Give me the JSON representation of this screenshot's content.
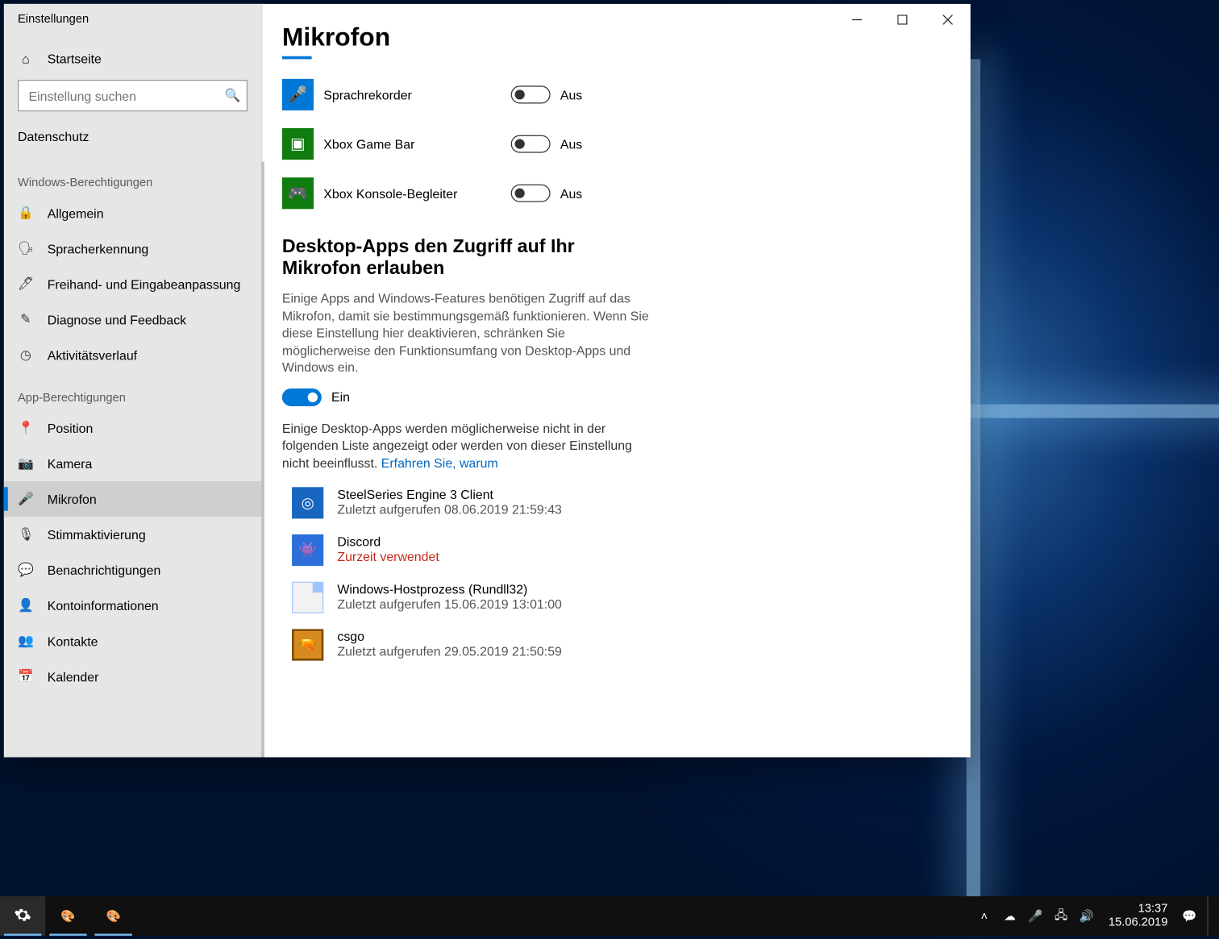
{
  "window": {
    "title": "Einstellungen"
  },
  "sidebar": {
    "home": "Startseite",
    "search_placeholder": "Einstellung suchen",
    "crumb": "Datenschutz",
    "group1_label": "Windows-Berechtigungen",
    "group1": [
      {
        "label": "Allgemein"
      },
      {
        "label": "Spracherkennung"
      },
      {
        "label": "Freihand- und Eingabeanpassung"
      },
      {
        "label": "Diagnose und Feedback"
      },
      {
        "label": "Aktivitätsverlauf"
      }
    ],
    "group2_label": "App-Berechtigungen",
    "group2": [
      {
        "label": "Position"
      },
      {
        "label": "Kamera"
      },
      {
        "label": "Mikrofon"
      },
      {
        "label": "Stimmaktivierung"
      },
      {
        "label": "Benachrichtigungen"
      },
      {
        "label": "Kontoinformationen"
      },
      {
        "label": "Kontakte"
      },
      {
        "label": "Kalender"
      }
    ]
  },
  "main": {
    "heading": "Mikrofon",
    "apps": [
      {
        "name": "Sprachrekorder",
        "state": "Aus"
      },
      {
        "name": "Xbox Game Bar",
        "state": "Aus"
      },
      {
        "name": "Xbox Konsole-Begleiter",
        "state": "Aus"
      }
    ],
    "section2_title": "Desktop-Apps den Zugriff auf Ihr Mikrofon erlauben",
    "section2_body": "Einige Apps and Windows-Features benötigen Zugriff auf das Mikrofon, damit sie bestimmungsgemäß funktionieren. Wenn Sie diese Einstellung hier deaktivieren, schränken Sie möglicherweise den Funktionsumfang von Desktop-Apps und Windows ein.",
    "master_toggle_state": "Ein",
    "section2_note": "Einige Desktop-Apps werden möglicherweise nicht in der folgenden Liste angezeigt oder werden von dieser Einstellung nicht beeinflusst.",
    "learn_more": "Erfahren Sie, warum",
    "desktop_apps": [
      {
        "name": "SteelSeries Engine 3 Client",
        "status": "Zuletzt aufgerufen 08.06.2019 21:59:43"
      },
      {
        "name": "Discord",
        "status": "Zurzeit verwendet"
      },
      {
        "name": "Windows-Hostprozess (Rundll32)",
        "status": "Zuletzt aufgerufen 15.06.2019 13:01:00"
      },
      {
        "name": "csgo",
        "status": "Zuletzt aufgerufen 29.05.2019 21:50:59"
      }
    ]
  },
  "taskbar": {
    "time": "13:37",
    "date": "15.06.2019"
  }
}
